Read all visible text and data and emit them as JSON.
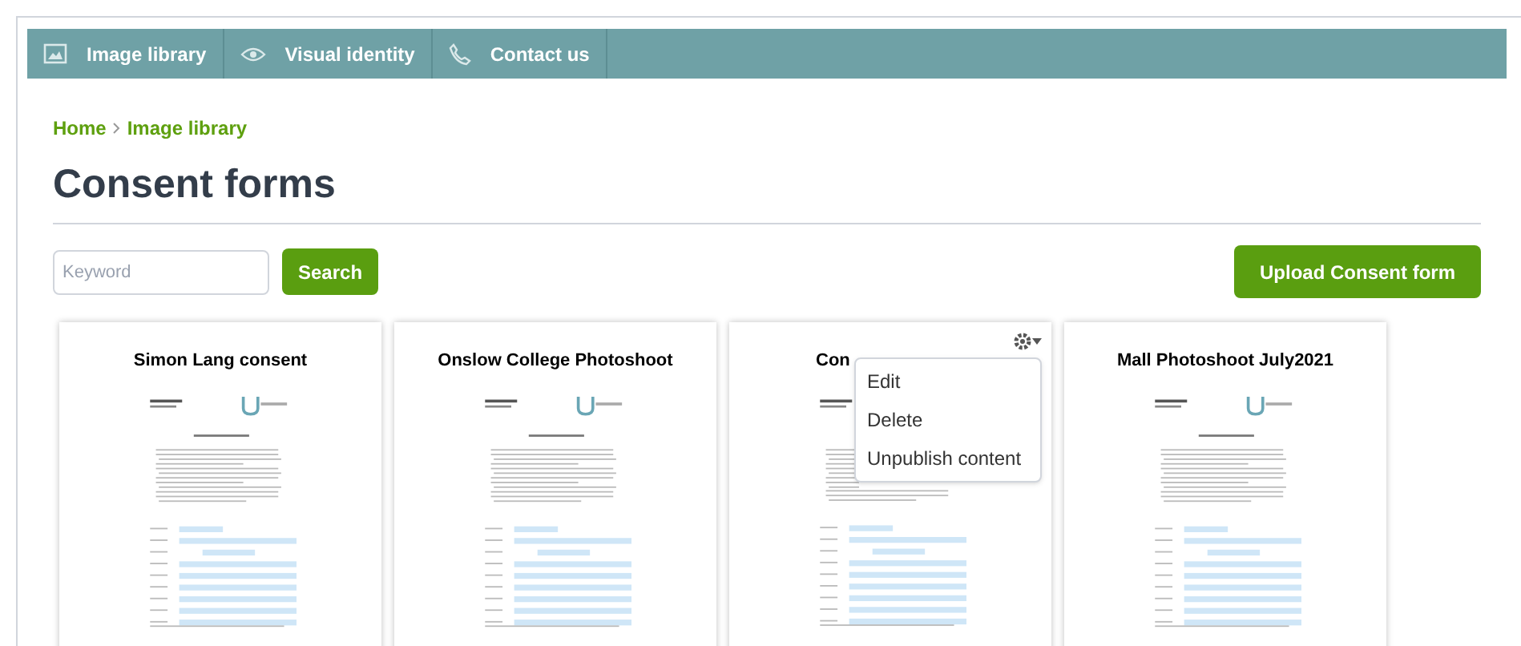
{
  "nav": [
    {
      "label": "Image library"
    },
    {
      "label": "Visual identity"
    },
    {
      "label": "Contact us"
    }
  ],
  "breadcrumb": [
    "Home",
    "Image library"
  ],
  "title": "Consent forms",
  "search": {
    "placeholder": "Keyword",
    "button": "Search"
  },
  "upload_button": "Upload Consent form",
  "cards": [
    {
      "title": "Simon Lang consent",
      "menu_open": false
    },
    {
      "title": "Onslow College Photoshoot",
      "menu_open": false
    },
    {
      "title": "Con",
      "menu_open": true
    },
    {
      "title": "Mall Photoshoot July2021",
      "menu_open": false
    }
  ],
  "menu": [
    "Edit",
    "Delete",
    "Unpublish content"
  ]
}
